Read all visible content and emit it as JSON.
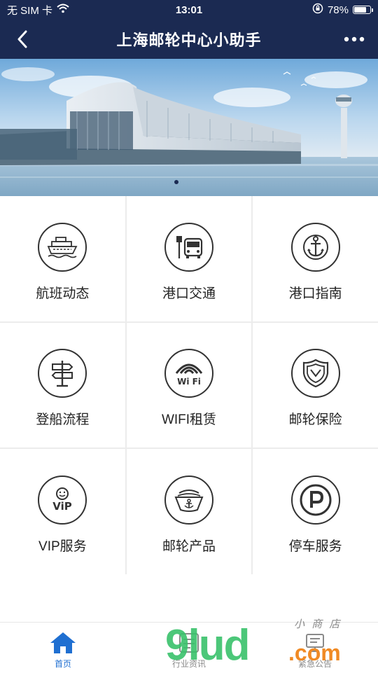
{
  "status_bar": {
    "carrier": "无 SIM 卡",
    "time": "13:01",
    "battery": "78%",
    "battery_level": 0.78,
    "icons": [
      "wifi-icon",
      "orientation-lock-icon",
      "battery-icon"
    ]
  },
  "nav": {
    "title": "上海邮轮中心小助手",
    "icons": [
      "back-chevron-icon",
      "more-dots-icon"
    ]
  },
  "banner": {
    "subject": "cruise-terminal-photo"
  },
  "grid": {
    "items": [
      {
        "label": "航班动态",
        "icon": "cruise-ship-icon"
      },
      {
        "label": "港口交通",
        "icon": "bus-stop-icon"
      },
      {
        "label": "港口指南",
        "icon": "anchor-icon"
      },
      {
        "label": "登船流程",
        "icon": "signpost-icon"
      },
      {
        "label": "WIFI租赁",
        "icon": "wifi-icon"
      },
      {
        "label": "邮轮保险",
        "icon": "shield-icon"
      },
      {
        "label": "VIP服务",
        "icon": "vip-smile-icon"
      },
      {
        "label": "邮轮产品",
        "icon": "ship-anchor-icon"
      },
      {
        "label": "停车服务",
        "icon": "parking-icon"
      }
    ]
  },
  "tab_bar": {
    "items": [
      {
        "label": "首页",
        "icon": "home-icon",
        "active": true
      },
      {
        "label": "行业资讯",
        "icon": "news-icon",
        "active": false
      },
      {
        "label": "紧急公告",
        "icon": "notice-icon",
        "active": false
      }
    ]
  },
  "watermark": {
    "main": "9lud",
    "com": ".com",
    "sub": "小 商 店"
  },
  "colors": {
    "nav_bg": "#1b2a52",
    "tab_active": "#1f6fd1",
    "grid_divider": "#ececec",
    "icon_stroke": "#333333"
  }
}
